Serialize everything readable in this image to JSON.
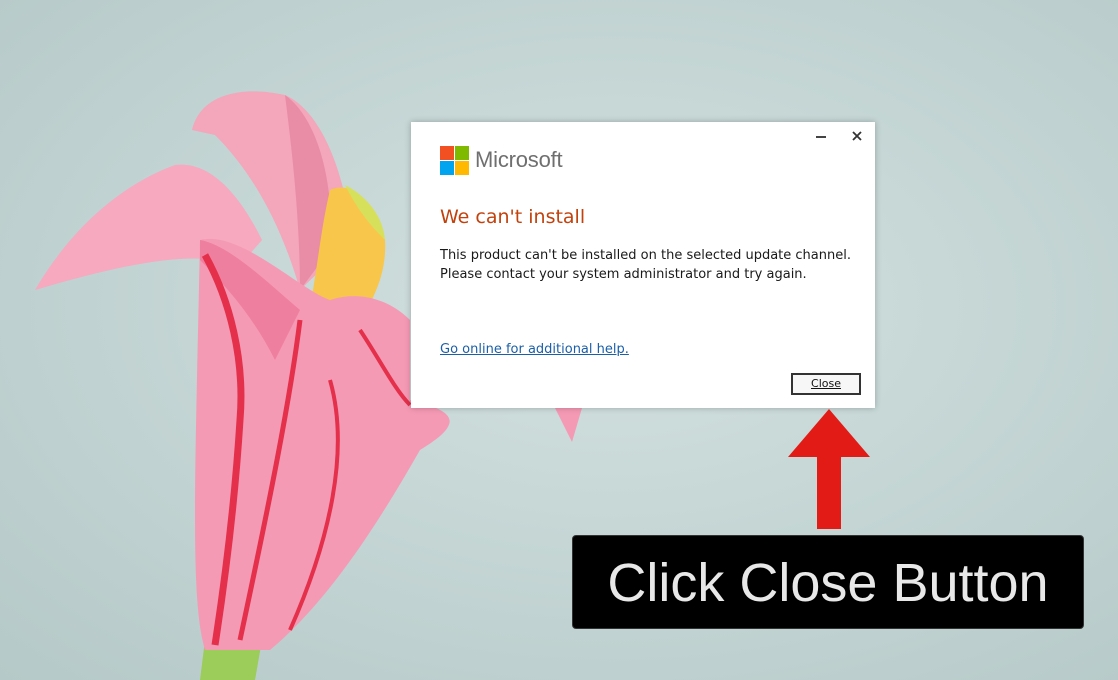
{
  "dialog": {
    "brand": {
      "name": "Microsoft",
      "logo_colors": [
        "#f25022",
        "#7fba00",
        "#00a4ef",
        "#ffb900"
      ]
    },
    "title_bar": {
      "minimize_icon": "minimize-icon",
      "close_icon": "close-icon"
    },
    "title": "We can't install",
    "body_lines": [
      "This product can't be installed on the selected update channel.",
      "Please contact your system administrator and try again."
    ],
    "help_link": "Go online for additional help.",
    "close_button_label": "Close",
    "colors": {
      "title": "#c2410c",
      "link": "#1a5fa8"
    }
  },
  "annotation": {
    "arrow_icon": "red-up-arrow-icon",
    "arrow_color": "#e31b17",
    "caption": "Click Close Button"
  },
  "background": {
    "description_icon": "pink-origami-lily-image"
  }
}
